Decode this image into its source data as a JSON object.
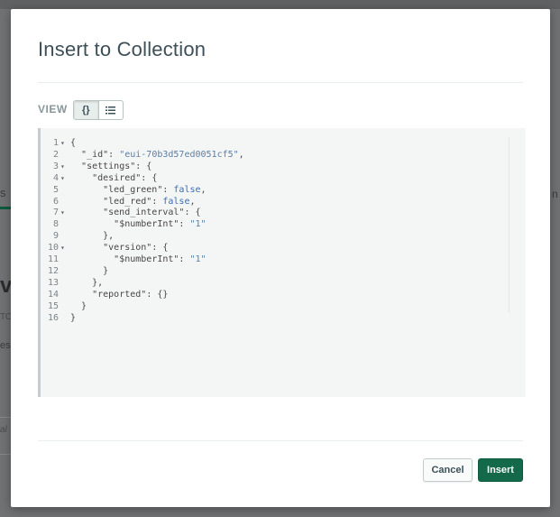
{
  "backdrop": {
    "fragment_left_1": "s",
    "fragment_left_2": "vi",
    "fragment_left_3": "TO",
    "fragment_left_4": "es",
    "fragment_left_5": "al",
    "fragment_right_1": "n"
  },
  "modal": {
    "title": "Insert to Collection",
    "view_label": "VIEW",
    "view_options": [
      {
        "name": "json-view",
        "icon": "braces-icon",
        "glyph": "{}",
        "active": true
      },
      {
        "name": "list-view",
        "icon": "list-icon",
        "glyph": "list",
        "active": false
      }
    ],
    "editor": {
      "lines": [
        {
          "n": "1",
          "fold": true,
          "text": "{"
        },
        {
          "n": "2",
          "fold": false,
          "text": "  \"_id\": \"eui-70b3d57ed0051cf5\","
        },
        {
          "n": "3",
          "fold": true,
          "text": "  \"settings\": {"
        },
        {
          "n": "4",
          "fold": true,
          "text": "    \"desired\": {"
        },
        {
          "n": "5",
          "fold": false,
          "text": "      \"led_green\": false,"
        },
        {
          "n": "6",
          "fold": false,
          "text": "      \"led_red\": false,"
        },
        {
          "n": "7",
          "fold": true,
          "text": "      \"send_interval\": {"
        },
        {
          "n": "8",
          "fold": false,
          "text": "        \"$numberInt\": \"1\""
        },
        {
          "n": "9",
          "fold": false,
          "text": "      },"
        },
        {
          "n": "10",
          "fold": true,
          "text": "      \"version\": {"
        },
        {
          "n": "11",
          "fold": false,
          "text": "        \"$numberInt\": \"1\""
        },
        {
          "n": "12",
          "fold": false,
          "text": "      }"
        },
        {
          "n": "13",
          "fold": false,
          "text": "    },"
        },
        {
          "n": "14",
          "fold": false,
          "text": "    \"reported\": {}"
        },
        {
          "n": "15",
          "fold": false,
          "text": "  }"
        },
        {
          "n": "16",
          "fold": false,
          "text": "}"
        }
      ]
    },
    "buttons": {
      "cancel": "Cancel",
      "insert": "Insert"
    }
  },
  "colors": {
    "accent": "#13694a",
    "title": "#3d4f58",
    "string": "#5b7fa6",
    "boolean": "#3c6eb4"
  }
}
